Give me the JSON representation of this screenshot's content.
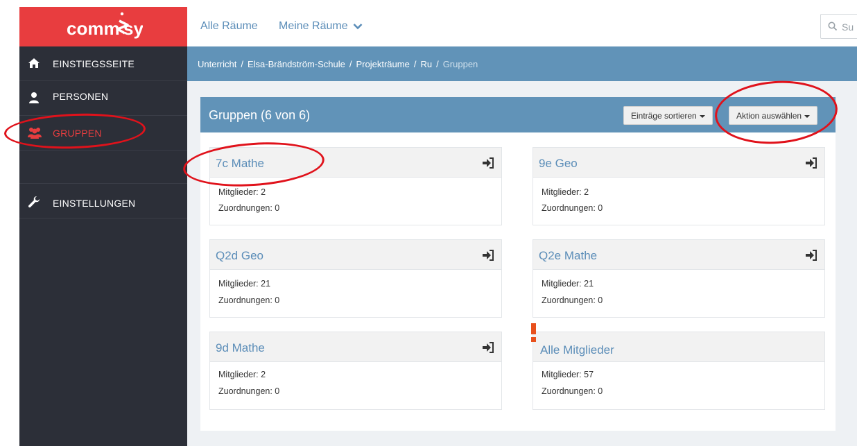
{
  "logo": {
    "text": "commsy"
  },
  "sidebar": {
    "items": [
      {
        "label": "EINSTIEGSSEITE",
        "icon": "home-icon"
      },
      {
        "label": "PERSONEN",
        "icon": "user-icon"
      },
      {
        "label": "GRUPPEN",
        "icon": "group-icon",
        "active": true
      },
      {
        "label": "EINSTELLUNGEN",
        "icon": "wrench-icon"
      }
    ]
  },
  "topbar": {
    "link_all_rooms": "Alle Räume",
    "link_my_rooms": "Meine Räume",
    "search_placeholder": "Su"
  },
  "breadcrumb": {
    "items": [
      "Unterricht",
      "Elsa-Brändström-Schule",
      "Projekträume",
      "Ru"
    ],
    "current": "Gruppen",
    "separator": "/"
  },
  "panel": {
    "title": "Gruppen (6 von 6)",
    "sort_button": "Einträge sortieren",
    "action_button": "Aktion auswählen"
  },
  "groups": [
    {
      "name": "7c Mathe",
      "members": "Mitglieder: 2",
      "assignments": "Zuordnungen: 0"
    },
    {
      "name": "9e Geo",
      "members": "Mitglieder: 2",
      "assignments": "Zuordnungen: 0"
    },
    {
      "name": "Q2d Geo",
      "members": "Mitglieder: 21",
      "assignments": "Zuordnungen: 0"
    },
    {
      "name": "Q2e Mathe",
      "members": "Mitglieder: 21",
      "assignments": "Zuordnungen: 0"
    },
    {
      "name": "9d Mathe",
      "members": "Mitglieder: 2",
      "assignments": "Zuordnungen: 0"
    },
    {
      "name": "Alle Mitglieder",
      "members": "Mitglieder: 57",
      "assignments": "Zuordnungen: 0"
    }
  ],
  "colors": {
    "brand": "#e83d3f",
    "sidebar": "#2c2f38",
    "accent": "#6193b8",
    "link": "#5b8db8",
    "annotation": "#e0121b"
  }
}
